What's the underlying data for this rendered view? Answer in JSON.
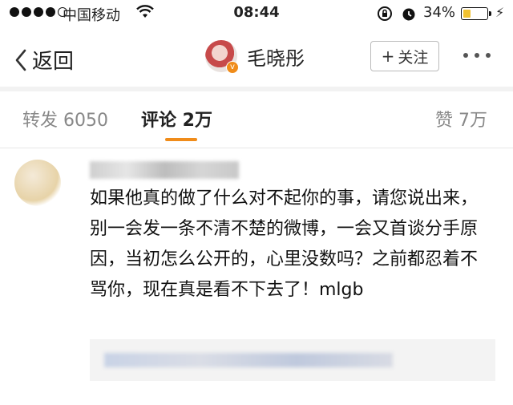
{
  "status_bar": {
    "carrier": "中国移动",
    "time": "08:44",
    "battery_pct": "34%",
    "battery_level": 0.34
  },
  "nav": {
    "back_label": "返回",
    "title": "毛晓彤",
    "follow_label": "关注"
  },
  "tabs": [
    {
      "label": "转发 6050"
    },
    {
      "label": "评论 2万"
    },
    {
      "label": "赞 7万"
    }
  ],
  "comment": {
    "text": "如果他真的做了什么对不起你的事，请您说出来，别一会发一条不清不楚的微博，一会又首谈分手原因，当初怎么公开的，心里没数吗？之前都忍着不骂你，现在真是看不下去了！mlgb"
  },
  "colors": {
    "accent": "#f08c1a",
    "battery": "#f2c230"
  }
}
